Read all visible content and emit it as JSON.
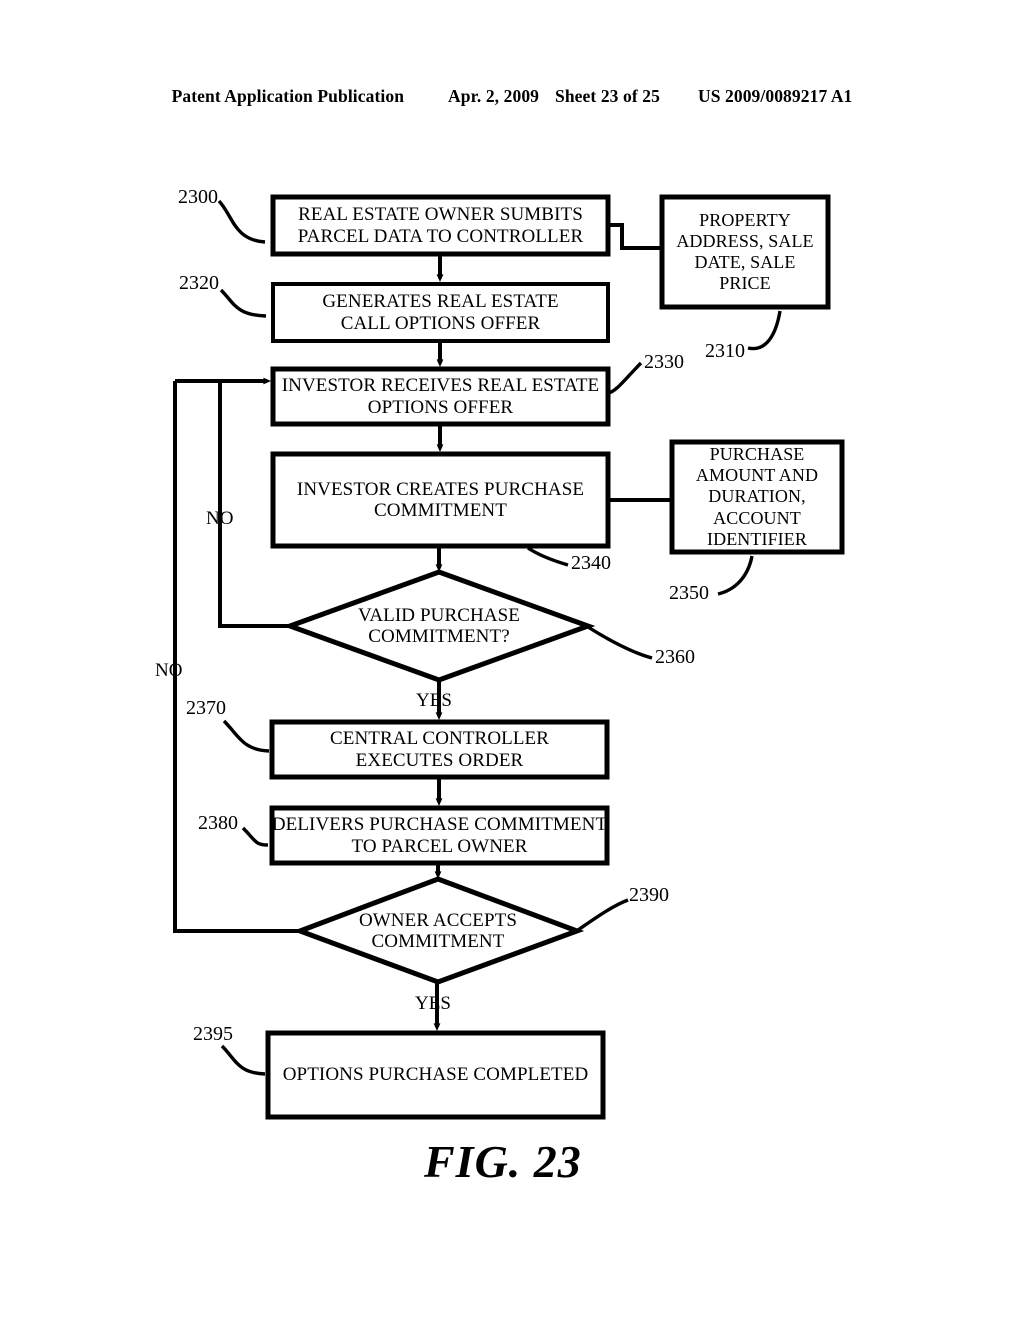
{
  "header": {
    "publication": "Patent Application Publication",
    "date": "Apr. 2, 2009",
    "sheet": "Sheet 23 of 25",
    "patent_number": "US 2009/0089217 A1"
  },
  "figure": {
    "caption": "FIG. 23",
    "nodes": [
      {
        "id": "2300",
        "ref": "2300",
        "type": "process",
        "text": "REAL ESTATE OWNER SUMBITS\nPARCEL DATA TO CONTROLLER"
      },
      {
        "id": "2310",
        "ref": "2310",
        "type": "data",
        "text": "PROPERTY\nADDRESS, SALE\nDATE, SALE\nPRICE"
      },
      {
        "id": "2320",
        "ref": "2320",
        "type": "process",
        "text": "GENERATES REAL ESTATE\nCALL OPTIONS OFFER"
      },
      {
        "id": "2330",
        "ref": "2330",
        "type": "process",
        "text": "INVESTOR RECEIVES REAL ESTATE\nOPTIONS OFFER"
      },
      {
        "id": "2340",
        "ref": "2340",
        "type": "process",
        "text": "INVESTOR CREATES PURCHASE\nCOMMITMENT"
      },
      {
        "id": "2350",
        "ref": "2350",
        "type": "data",
        "text": "PURCHASE\nAMOUNT AND\nDURATION,\nACCOUNT\nIDENTIFIER"
      },
      {
        "id": "2360",
        "ref": "2360",
        "type": "decision",
        "text": "VALID PURCHASE\nCOMMITMENT?"
      },
      {
        "id": "2370",
        "ref": "2370",
        "type": "process",
        "text": "CENTRAL CONTROLLER\nEXECUTES ORDER"
      },
      {
        "id": "2380",
        "ref": "2380",
        "type": "process",
        "text": "DELIVERS PURCHASE COMMITMENT\nTO PARCEL OWNER"
      },
      {
        "id": "2390",
        "ref": "2390",
        "type": "decision",
        "text": "OWNER ACCEPTS\nCOMMITMENT"
      },
      {
        "id": "2395",
        "ref": "2395",
        "type": "process",
        "text": "OPTIONS PURCHASE COMPLETED"
      }
    ],
    "edge_labels": {
      "no_inner": "NO",
      "no_outer": "NO",
      "yes_valid": "YES",
      "yes_accept": "YES"
    }
  }
}
